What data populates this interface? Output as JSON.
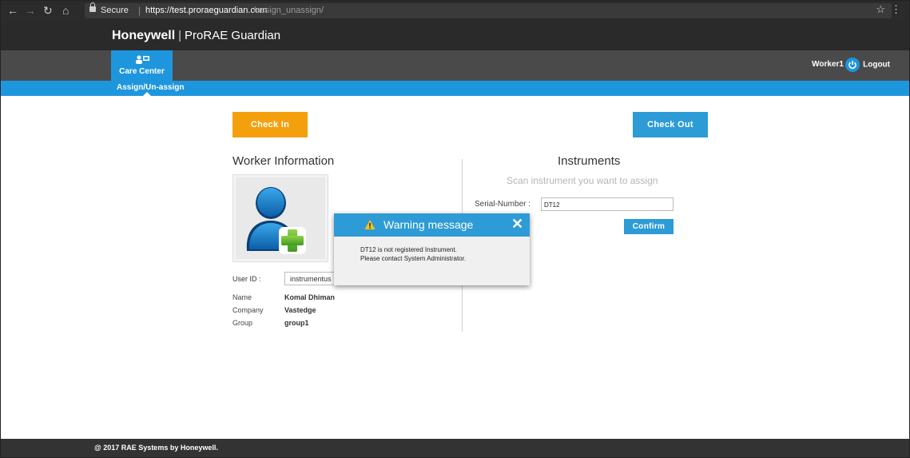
{
  "browser": {
    "secure_label": "Secure",
    "url_host": "https://test.proraeguardian.com",
    "url_path": "/assign_unassign/"
  },
  "brand": {
    "company": "Honeywell",
    "product": "ProRAE Guardian"
  },
  "nav": {
    "care_center_label": "Care Center",
    "sub_item": "Assign/Un-assign",
    "user": "Worker1",
    "logout_label": "Logout",
    "accent_color": "#1e96dd"
  },
  "actions": {
    "checkin_label": "Check In",
    "checkout_label": "Check Out",
    "checkin_color": "#f4a00d"
  },
  "worker": {
    "title": "Worker Information",
    "user_id_label": "User ID :",
    "user_id_value": "instrumentus",
    "name_label": "Name",
    "name_value": "Komal Dhiman",
    "company_label": "Company",
    "company_value": "Vastedge",
    "group_label": "Group",
    "group_value": "group1"
  },
  "instruments": {
    "title": "Instruments",
    "scan_prompt": "Scan instrument you want to assign",
    "serial_label": "Serial-Number :",
    "serial_value": "DT12",
    "confirm_label": "Confirm"
  },
  "modal": {
    "title": "Warning message",
    "line1": "DT12 is not registered Instrument.",
    "line2": "Please contact System Administrator."
  },
  "footer": {
    "copyright": "@ 2017 RAE Systems by Honeywell."
  }
}
